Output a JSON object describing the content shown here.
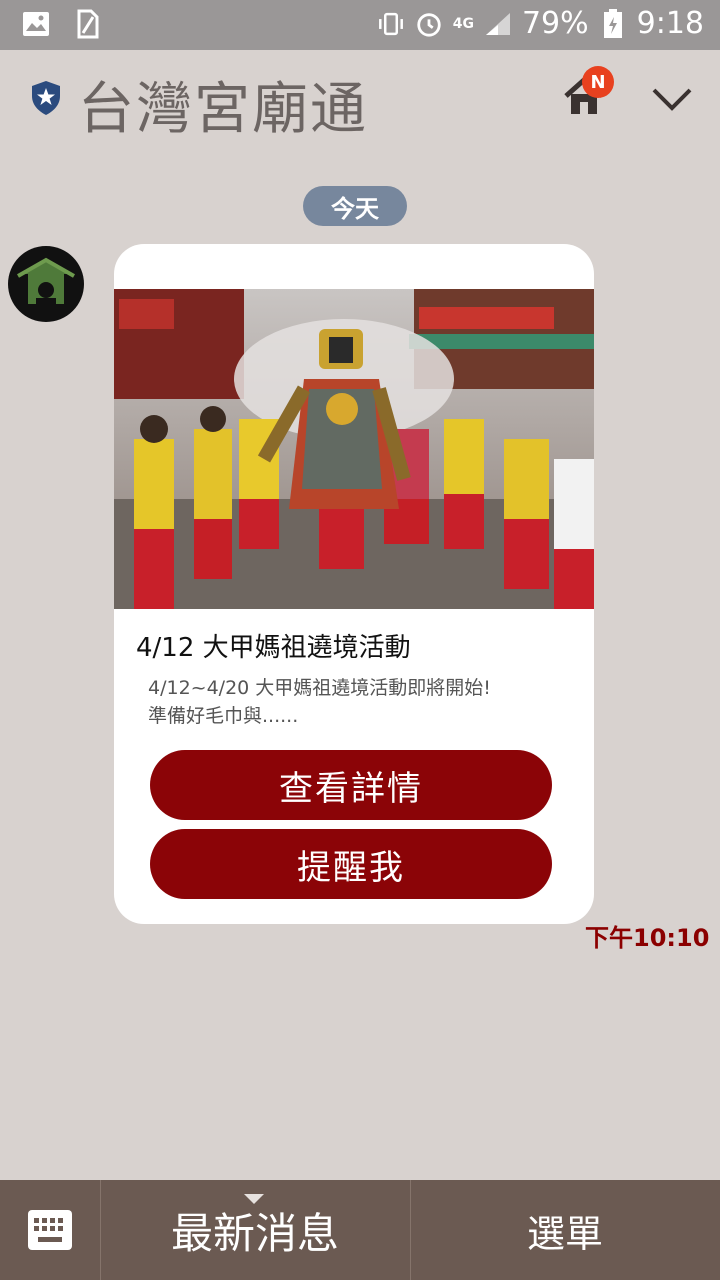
{
  "statusbar": {
    "battery": "79%",
    "time": "9:18",
    "network": "4G",
    "icons": [
      "image-icon",
      "sim-icon",
      "vibrate-icon",
      "alarm-icon",
      "signal-icon",
      "battery-icon"
    ]
  },
  "header": {
    "title": "台灣宮廟通",
    "badge": "N",
    "icons": [
      "shield-star-icon",
      "home-icon",
      "chevron-down-icon"
    ]
  },
  "chat": {
    "date_label": "今天",
    "message": {
      "title": "4/12 大甲媽祖遶境活動",
      "description_line1": "4/12~4/20 大甲媽祖遶境活動即將開始!",
      "description_line2": "準備好毛巾與......",
      "button_detail": "查看詳情",
      "button_remind": "提醒我",
      "time": "下午10:10"
    }
  },
  "bottombar": {
    "news_label": "最新消息",
    "menu_label": "選單",
    "icons": [
      "keyboard-icon"
    ]
  },
  "colors": {
    "background": "#d8d2cf",
    "accent_button": "#8b0407",
    "bottombar": "#6b5a52",
    "date_pill": "#77879d",
    "badge": "#e8411f"
  }
}
